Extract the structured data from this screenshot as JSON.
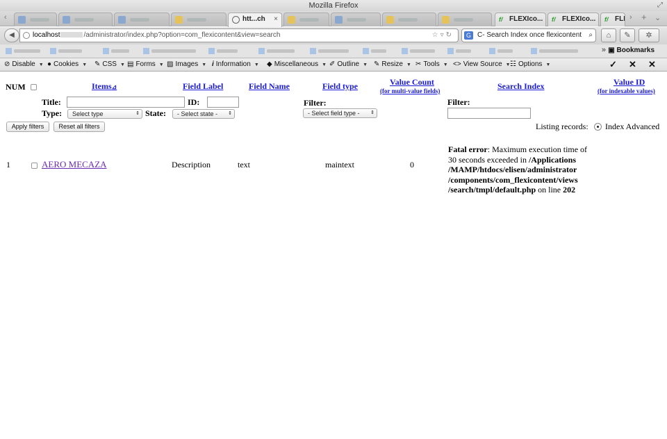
{
  "window": {
    "title": "Mozilla Firefox"
  },
  "tabs": {
    "active_label": "htt...ch",
    "flexi_1": "FLEXIco...",
    "flexi_2": "FLEXIco...",
    "flexi_3": "FLI"
  },
  "nav": {
    "url_host": "localhost",
    "url_path": "/administrator/index.php?option=com_flexicontent&view=search",
    "search_text": "C- Search Index once flexicontent"
  },
  "bookmarks": {
    "label": "Bookmarks"
  },
  "devtools": {
    "disable": "Disable",
    "cookies": "Cookies",
    "css": "CSS",
    "forms": "Forms",
    "images": "Images",
    "information": "Information",
    "miscellaneous": "Miscellaneous",
    "outline": "Outline",
    "resize": "Resize",
    "tools": "Tools",
    "view_source": "View Source",
    "options": "Options"
  },
  "table": {
    "headers": {
      "num": "NUM",
      "items": "Items",
      "field_label": "Field Label",
      "field_name": "Field Name",
      "field_type": "Field type",
      "value_count": "Value Count",
      "value_count_sub": "(for multi-value fields)",
      "search_index": "Search Index",
      "value_id": "Value ID",
      "value_id_sub": "(for indexable values)"
    },
    "filters": {
      "title_label": "Title:",
      "id_label": "ID:",
      "type_label": "Type:",
      "type_select": "Select type",
      "state_label": "State:",
      "state_select": "- Select state -",
      "filter_label": "Filter:",
      "field_type_select": "- Select field type -",
      "filter_label_2": "Filter:",
      "apply_button": "Apply filters",
      "reset_button": "Reset all filters",
      "listing_label": "Listing records:",
      "listing_option": "Index Advanced"
    },
    "rows": [
      {
        "num": "1",
        "item": "AERO MECAZA",
        "field_label": "Description",
        "field_name": "text",
        "field_type": "maintext",
        "value_count": "0"
      }
    ]
  },
  "error": {
    "prefix": "Fatal error",
    "message": ": Maximum execution time of 30 seconds exceeded in ",
    "path": "/Applications /MAMP/htdocs/elisen/administrator /components/com_flexicontent/views /search/tmpl/default.php",
    "line_text": " on line ",
    "line": "202"
  }
}
